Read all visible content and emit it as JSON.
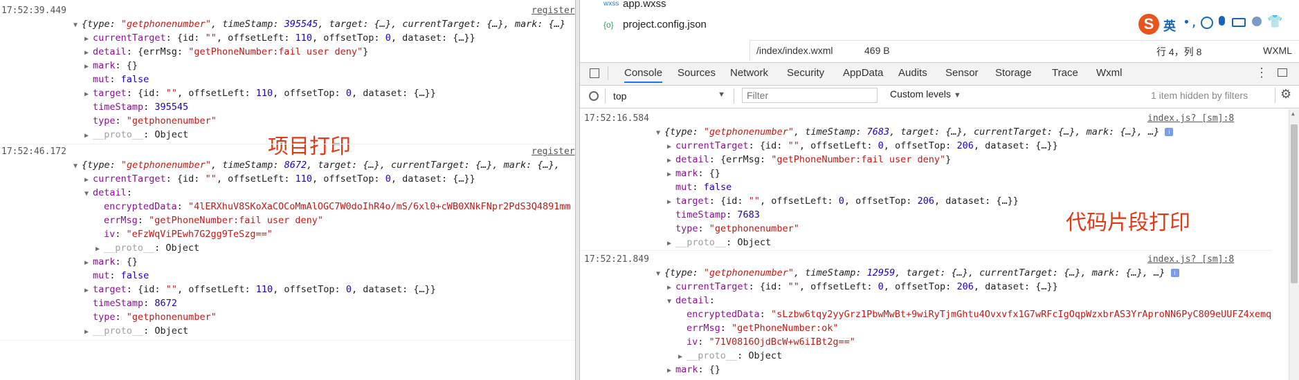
{
  "left": {
    "source": "register",
    "annotation": "项目打印",
    "entry1": {
      "time": "17:52:39.449",
      "head": [
        "{type: ",
        "\"getphonenumber\"",
        ", timeStamp: ",
        "395545",
        ", target: {…}, currentTarget: {…}, mark: {…}"
      ],
      "currentTarget": [
        "currentTarget",
        ": {id: ",
        "\"\"",
        ", offsetLeft: ",
        "110",
        ", offsetTop: ",
        "0",
        ", dataset: {…}}"
      ],
      "detail": [
        "detail",
        ": {errMsg: ",
        "\"getPhoneNumber:fail user deny\"",
        "}"
      ],
      "mark": [
        "mark",
        ": {}"
      ],
      "mut": [
        "mut",
        ": ",
        "false"
      ],
      "target": [
        "target",
        ": {id: ",
        "\"\"",
        ", offsetLeft: ",
        "110",
        ", offsetTop: ",
        "0",
        ", dataset: {…}}"
      ],
      "timeStamp": [
        "timeStamp",
        ": ",
        "395545"
      ],
      "type": [
        "type",
        ": ",
        "\"getphonenumber\""
      ],
      "proto": [
        "__proto__",
        ": Object"
      ]
    },
    "entry2": {
      "time": "17:52:46.172",
      "head": [
        "{type: ",
        "\"getphonenumber\"",
        ", timeStamp: ",
        "8672",
        ", target: {…}, currentTarget: {…}, mark: {…}, "
      ],
      "currentTarget": [
        "currentTarget",
        ": {id: ",
        "\"\"",
        ", offsetLeft: ",
        "110",
        ", offsetTop: ",
        "0",
        ", dataset: {…}}"
      ],
      "detail": [
        "detail",
        ":"
      ],
      "encryptedData": [
        "encryptedData",
        ": ",
        "\"4lERXhuV8SKoXaCOCoMmAlOGC7W0doIhR4o/mS/6xl0+cWB0XNkFNpr2PdS3Q4891mm"
      ],
      "errMsg": [
        "errMsg",
        ": ",
        "\"getPhoneNumber:fail user deny\""
      ],
      "iv": [
        "iv",
        ": ",
        "\"eFzWqViPEwh7G2gg9TeSzg==\""
      ],
      "proto_inner": [
        "__proto__",
        ": Object"
      ],
      "mark": [
        "mark",
        ": {}"
      ],
      "mut": [
        "mut",
        ": ",
        "false"
      ],
      "target": [
        "target",
        ": {id: ",
        "\"\"",
        ", offsetLeft: ",
        "110",
        ", offsetTop: ",
        "0",
        ", dataset: {…}}"
      ],
      "timeStamp": [
        "timeStamp",
        ": ",
        "8672"
      ],
      "type": [
        "type",
        ": ",
        "\"getphonenumber\""
      ],
      "proto": [
        "__proto__",
        ": Object"
      ]
    }
  },
  "right": {
    "files": [
      {
        "icon": "wxss",
        "name": "app.wxss"
      },
      {
        "icon": "{o}",
        "name": "project.config.json"
      }
    ],
    "editor": {
      "path": "/index/index.wxml",
      "size": "469 B",
      "position": "行 4，列 8",
      "lang": "WXML"
    },
    "ime": {
      "label": "英"
    },
    "tabs": [
      "Console",
      "Sources",
      "Network",
      "Security",
      "AppData",
      "Audits",
      "Sensor",
      "Storage",
      "Trace",
      "Wxml"
    ],
    "toolbar": {
      "context": "top",
      "filter_placeholder": "Filter",
      "levels": "Custom levels",
      "hidden": "1 item hidden by filters"
    },
    "annotation": "代码片段打印",
    "source": "index.js? [sm]:8",
    "entry1": {
      "time": "17:52:16.584",
      "head": [
        "{type: ",
        "\"getphonenumber\"",
        ", timeStamp: ",
        "7683",
        ", target: {…}, currentTarget: {…}, mark: {…}, …}"
      ],
      "currentTarget": [
        "currentTarget",
        ": {id: ",
        "\"\"",
        ", offsetLeft: ",
        "0",
        ", offsetTop: ",
        "206",
        ", dataset: {…}}"
      ],
      "detail": [
        "detail",
        ": {errMsg: ",
        "\"getPhoneNumber:fail user deny\"",
        "}"
      ],
      "mark": [
        "mark",
        ": {}"
      ],
      "mut": [
        "mut",
        ": ",
        "false"
      ],
      "target": [
        "target",
        ": {id: ",
        "\"\"",
        ", offsetLeft: ",
        "0",
        ", offsetTop: ",
        "206",
        ", dataset: {…}}"
      ],
      "timeStamp": [
        "timeStamp",
        ": ",
        "7683"
      ],
      "type": [
        "type",
        ": ",
        "\"getphonenumber\""
      ],
      "proto": [
        "__proto__",
        ": Object"
      ]
    },
    "entry2": {
      "time": "17:52:21.849",
      "head": [
        "{type: ",
        "\"getphonenumber\"",
        ", timeStamp: ",
        "12959",
        ", target: {…}, currentTarget: {…}, mark: {…}, …}"
      ],
      "currentTarget": [
        "currentTarget",
        ": {id: ",
        "\"\"",
        ", offsetLeft: ",
        "0",
        ", offsetTop: ",
        "206",
        ", dataset: {…}}"
      ],
      "detail": [
        "detail",
        ":"
      ],
      "encryptedData": [
        "encryptedData",
        ": ",
        "\"sLzbw6tqy2yyGrz1PbwMwBt+9wiRyTjmGhtu4Ovxvfx1G7wRFcIgOqpWzxbrAS3YrAproNN6PyC809eUUFZ4xemq"
      ],
      "errMsg": [
        "errMsg",
        ": ",
        "\"getPhoneNumber:ok\""
      ],
      "iv": [
        "iv",
        ": ",
        "\"71V0816OjdBcW+w6iIBt2g==\""
      ],
      "proto_inner": [
        "__proto__",
        ": Object"
      ],
      "mark": [
        "mark",
        ": {}"
      ]
    }
  }
}
